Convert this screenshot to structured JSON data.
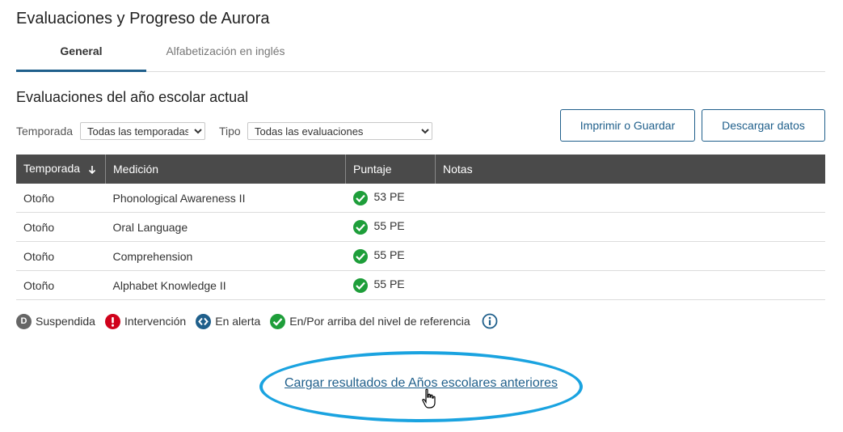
{
  "page": {
    "title": "Evaluaciones y Progreso de Aurora"
  },
  "tabs": [
    {
      "label": "General",
      "active": true
    },
    {
      "label": "Alfabetización en inglés",
      "active": false
    }
  ],
  "section": {
    "title": "Evaluaciones del año escolar actual"
  },
  "filters": {
    "season_label": "Temporada",
    "season_value": "Todas las temporadas",
    "type_label": "Tipo",
    "type_value": "Todas las evaluaciones"
  },
  "buttons": {
    "print": "Imprimir o Guardar",
    "download": "Descargar datos"
  },
  "table": {
    "headers": [
      "Temporada",
      "Medición",
      "Puntaje",
      "Notas"
    ],
    "rows": [
      {
        "season": "Otoño",
        "measure": "Phonological Awareness II",
        "score": "53 PE",
        "notes": ""
      },
      {
        "season": "Otoño",
        "measure": "Oral Language",
        "score": "55 PE",
        "notes": ""
      },
      {
        "season": "Otoño",
        "measure": "Comprehension",
        "score": "55 PE",
        "notes": ""
      },
      {
        "season": "Otoño",
        "measure": "Alphabet Knowledge II",
        "score": "55 PE",
        "notes": ""
      }
    ]
  },
  "legend": {
    "suspended": "Suspendida",
    "suspended_letter": "D",
    "intervention": "Intervención",
    "alert": "En alerta",
    "on_track": "En/Por arriba del nivel de referencia"
  },
  "link": {
    "prior_years": "Cargar resultados de Años escolares anteriores"
  },
  "colors": {
    "accent": "#1f5f8b",
    "header_bg": "#4a4a4a",
    "ok": "#1e9e3a",
    "danger": "#d0021b",
    "alert": "#1f5f8b",
    "suspended": "#666666",
    "highlight": "#1aa3e0"
  }
}
